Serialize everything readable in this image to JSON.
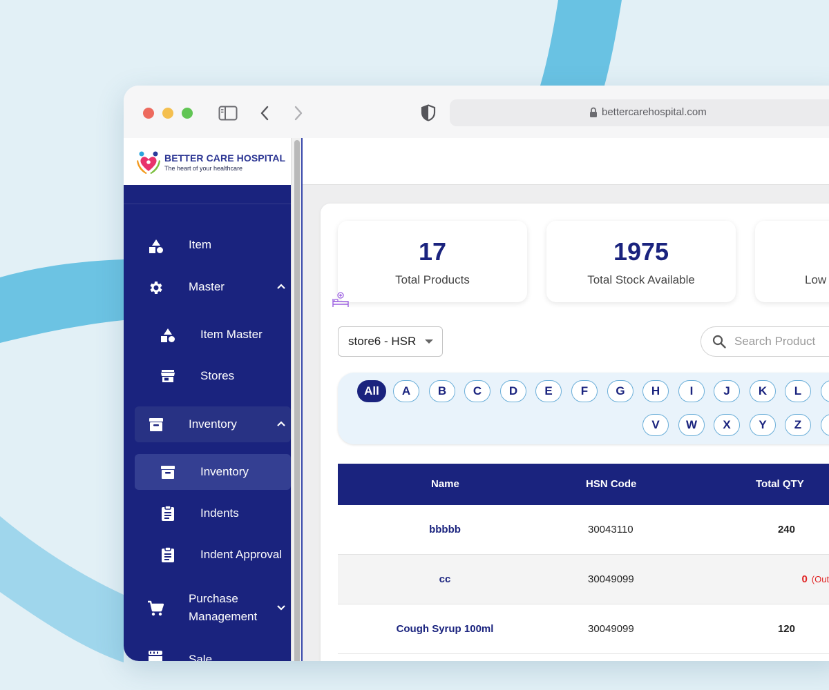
{
  "browser": {
    "url": "bettercarehospital.com"
  },
  "brand": {
    "name": "BETTER CARE HOSPITAL",
    "tagline": "The heart of your healthcare"
  },
  "sidebar": {
    "items": [
      {
        "label": "Item",
        "icon": "shapes-icon"
      },
      {
        "label": "Master",
        "icon": "gear-icon",
        "expanded": true
      },
      {
        "label": "Item Master",
        "icon": "shapes-icon"
      },
      {
        "label": "Stores",
        "icon": "store-icon"
      },
      {
        "label": "Inventory",
        "icon": "archive-box-icon",
        "expanded": true
      },
      {
        "label": "Inventory",
        "icon": "archive-box-icon",
        "selected": true
      },
      {
        "label": "Indents",
        "icon": "clipboard-icon"
      },
      {
        "label": "Indent Approval",
        "icon": "clipboard-icon"
      },
      {
        "label": "Purchase Management",
        "label_line1": "Purchase",
        "label_line2": "Management",
        "icon": "cart-icon",
        "expanded": false
      },
      {
        "label": "Sale",
        "icon": "register-icon"
      }
    ]
  },
  "stats": [
    {
      "value": "17",
      "label": "Total Products"
    },
    {
      "value": "1975",
      "label": "Total Stock Available"
    },
    {
      "value": "",
      "label": "Low"
    }
  ],
  "filters": {
    "store": "store6 - HSR",
    "search_placeholder": "Search Product"
  },
  "alphabet": {
    "row1": [
      "All",
      "A",
      "B",
      "C",
      "D",
      "E",
      "F",
      "G",
      "H",
      "I",
      "J",
      "K",
      "L"
    ],
    "row2": [
      "V",
      "W",
      "X",
      "Y",
      "Z"
    ],
    "selected": "All"
  },
  "table": {
    "headers": {
      "name": "Name",
      "hsn": "HSN Code",
      "qty": "Total QTY"
    },
    "rows": [
      {
        "name": "bbbbb",
        "hsn": "30043110",
        "qty": "240"
      },
      {
        "name": "cc",
        "hsn": "30049099",
        "qty": "0",
        "qty_note": "(Out of Stock)"
      },
      {
        "name": "Cough Syrup 100ml",
        "hsn": "30049099",
        "qty": "120"
      }
    ]
  },
  "colors": {
    "sidebar": "#1a237e",
    "accent": "#1a237e",
    "out_of_stock": "#e02424",
    "background": "#e2f0f6"
  }
}
